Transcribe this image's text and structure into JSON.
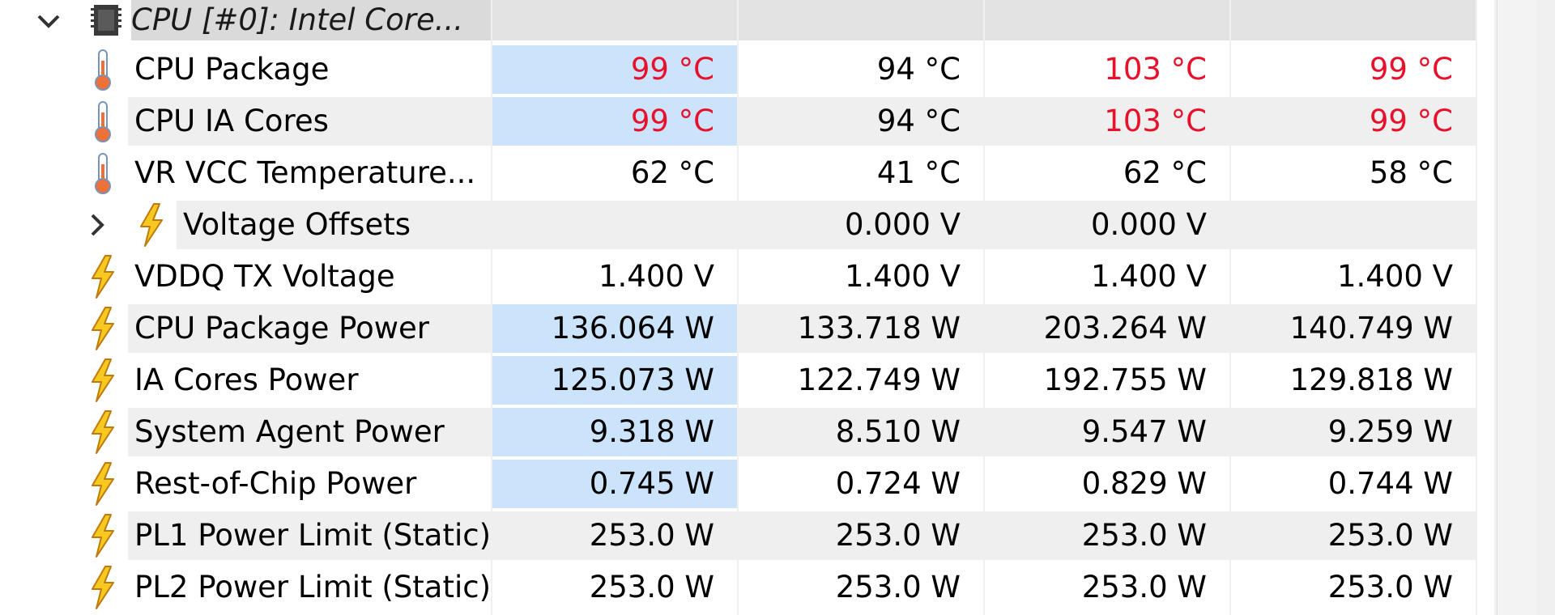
{
  "group": {
    "title": "CPU [#0]: Intel Core...",
    "icon": "cpu-chip-icon",
    "expanded": true
  },
  "rows": [
    {
      "name": "CPU Package",
      "icon": "thermometer-icon",
      "values": [
        "99 °C",
        "94 °C",
        "103 °C",
        "99 °C"
      ],
      "hot": [
        true,
        false,
        true,
        true
      ],
      "selected_first": true
    },
    {
      "name": "CPU IA Cores",
      "icon": "thermometer-icon",
      "values": [
        "99 °C",
        "94 °C",
        "103 °C",
        "99 °C"
      ],
      "hot": [
        true,
        false,
        true,
        true
      ],
      "selected_first": true
    },
    {
      "name": "VR VCC Temperature...",
      "icon": "thermometer-icon",
      "values": [
        "62 °C",
        "41 °C",
        "62 °C",
        "58 °C"
      ],
      "hot": [
        false,
        false,
        false,
        false
      ],
      "selected_first": false
    },
    {
      "name": "Voltage Offsets",
      "icon": "lightning-icon",
      "values": [
        "",
        "0.000 V",
        "0.000 V",
        ""
      ],
      "hot": [
        false,
        false,
        false,
        false
      ],
      "selected_first": false,
      "collapsible": true
    },
    {
      "name": "VDDQ TX Voltage",
      "icon": "lightning-icon",
      "values": [
        "1.400 V",
        "1.400 V",
        "1.400 V",
        "1.400 V"
      ],
      "hot": [
        false,
        false,
        false,
        false
      ],
      "selected_first": false
    },
    {
      "name": "CPU Package Power",
      "icon": "lightning-icon",
      "values": [
        "136.064 W",
        "133.718 W",
        "203.264 W",
        "140.749 W"
      ],
      "hot": [
        false,
        false,
        false,
        false
      ],
      "selected_first": true
    },
    {
      "name": "IA Cores Power",
      "icon": "lightning-icon",
      "values": [
        "125.073 W",
        "122.749 W",
        "192.755 W",
        "129.818 W"
      ],
      "hot": [
        false,
        false,
        false,
        false
      ],
      "selected_first": true
    },
    {
      "name": "System Agent Power",
      "icon": "lightning-icon",
      "values": [
        "9.318 W",
        "8.510 W",
        "9.547 W",
        "9.259 W"
      ],
      "hot": [
        false,
        false,
        false,
        false
      ],
      "selected_first": true
    },
    {
      "name": "Rest-of-Chip Power",
      "icon": "lightning-icon",
      "values": [
        "0.745 W",
        "0.724 W",
        "0.829 W",
        "0.744 W"
      ],
      "hot": [
        false,
        false,
        false,
        false
      ],
      "selected_first": true
    },
    {
      "name": "PL1 Power Limit (Static)",
      "icon": "lightning-icon",
      "values": [
        "253.0 W",
        "253.0 W",
        "253.0 W",
        "253.0 W"
      ],
      "hot": [
        false,
        false,
        false,
        false
      ],
      "selected_first": false
    },
    {
      "name": "PL2 Power Limit (Static)",
      "icon": "lightning-icon",
      "values": [
        "253.0 W",
        "253.0 W",
        "253.0 W",
        "253.0 W"
      ],
      "hot": [
        false,
        false,
        false,
        false
      ],
      "selected_first": false
    }
  ],
  "colors": {
    "hot": "#e8102a",
    "selection": "#cce4fb",
    "alt_row": "#efefef",
    "header": "#e3e3e3"
  }
}
